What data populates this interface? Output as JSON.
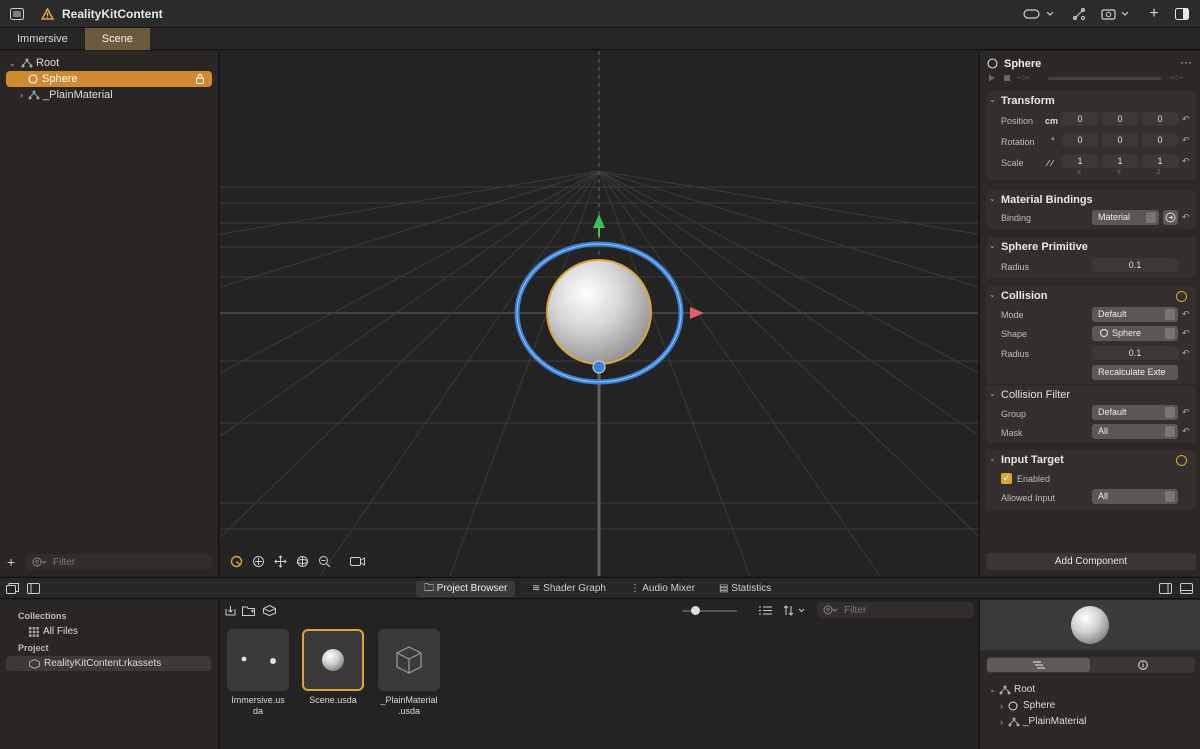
{
  "app": {
    "title": "RealityKitContent"
  },
  "tabs": [
    {
      "label": "Immersive"
    },
    {
      "label": "Scene"
    }
  ],
  "outline": {
    "items": [
      {
        "label": "Root"
      },
      {
        "label": "Sphere"
      },
      {
        "label": "_PlainMaterial"
      }
    ],
    "filter_placeholder": "Filter"
  },
  "inspector": {
    "entity_name": "Sphere",
    "time_start": "--:--",
    "time_end": "--:--",
    "transform": {
      "title": "Transform",
      "position_label": "Position",
      "position_unit": "cm",
      "position": [
        "0",
        "0",
        "0"
      ],
      "rotation_label": "Rotation",
      "rotation_unit": "°",
      "rotation": [
        "0",
        "0",
        "0"
      ],
      "scale_label": "Scale",
      "scale": [
        "1",
        "1",
        "1"
      ],
      "axes": [
        "X",
        "Y",
        "Z"
      ]
    },
    "material_bindings": {
      "title": "Material Bindings",
      "binding_label": "Binding",
      "binding_value": "Material"
    },
    "sphere_primitive": {
      "title": "Sphere Primitive",
      "radius_label": "Radius",
      "radius_value": "0.1"
    },
    "collision": {
      "title": "Collision",
      "mode_label": "Mode",
      "mode_value": "Default",
      "shape_label": "Shape",
      "shape_value": "Sphere",
      "radius_label": "Radius",
      "radius_value": "0.1",
      "recalc_label": "Recalculate Exte"
    },
    "collision_filter": {
      "title": "Collision Filter",
      "group_label": "Group",
      "group_value": "Default",
      "mask_label": "Mask",
      "mask_value": "All"
    },
    "input_target": {
      "title": "Input Target",
      "enabled_label": "Enabled",
      "allowed_label": "Allowed Input",
      "allowed_value": "All"
    },
    "add_component": "Add Component"
  },
  "bottom_tabs": [
    {
      "label": "Project Browser"
    },
    {
      "label": "Shader Graph"
    },
    {
      "label": "Audio Mixer"
    },
    {
      "label": "Statistics"
    }
  ],
  "collections": {
    "header": "Collections",
    "all_files": "All Files",
    "project_header": "Project",
    "project_item": "RealityKitContent.rkassets"
  },
  "browser": {
    "filter_placeholder": "Filter",
    "assets": [
      {
        "name_line1": "Immersive.us",
        "name_line2": "da"
      },
      {
        "name_line1": "Scene.usda",
        "name_line2": ""
      },
      {
        "name_line1": "_PlainMaterial",
        "name_line2": ".usda"
      }
    ]
  },
  "preview_tree": [
    {
      "label": "Root"
    },
    {
      "label": "Sphere"
    },
    {
      "label": "_PlainMaterial"
    }
  ],
  "colors": {
    "accent": "#cf8a30",
    "gizmo_ring": "#3b82d6",
    "selection": "#d9a63a"
  }
}
